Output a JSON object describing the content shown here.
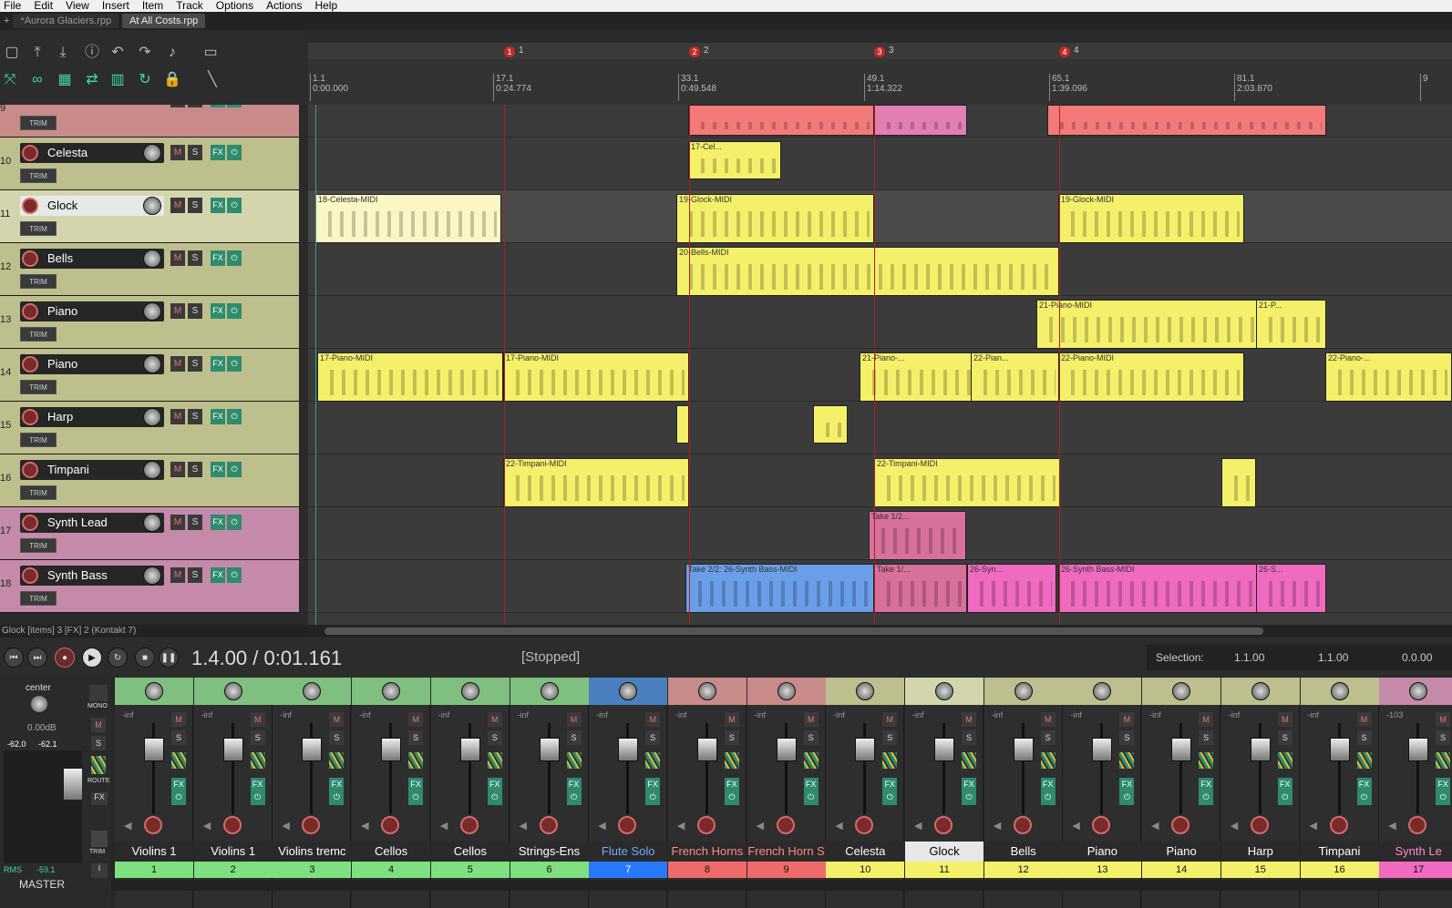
{
  "menu": [
    "File",
    "Edit",
    "View",
    "Insert",
    "Item",
    "Track",
    "Options",
    "Actions",
    "Help"
  ],
  "project_tabs": [
    "*Aurora Glaciers.rpp",
    "At All Costs.rpp"
  ],
  "toolbar_icons": [
    "new-project-icon",
    "open-icon",
    "save-icon",
    "info-icon",
    "undo-icon",
    "redo-icon",
    "metronome-icon",
    "window-icon",
    "ripple-icon",
    "link-icon",
    "grid-icon",
    "snap-icon",
    "grid-lines-icon",
    "loop-icon",
    "lock-icon",
    "razor-icon"
  ],
  "markers": [
    {
      "num": "1",
      "label": "1"
    },
    {
      "num": "2",
      "label": "2"
    },
    {
      "num": "3",
      "label": "3"
    },
    {
      "num": "4",
      "label": "4"
    }
  ],
  "ruler": [
    {
      "bar": "1.1",
      "time": "0:00.000"
    },
    {
      "bar": "17.1",
      "time": "0:24.774"
    },
    {
      "bar": "33.1",
      "time": "0:49.548"
    },
    {
      "bar": "49.1",
      "time": "1:14.322"
    },
    {
      "bar": "65.1",
      "time": "1:39.096"
    },
    {
      "bar": "81.1",
      "time": "2:03.870"
    },
    {
      "bar": "9",
      "time": ""
    }
  ],
  "tracks": [
    {
      "num": "9",
      "name": "",
      "color": "#c98a8a"
    },
    {
      "num": "10",
      "name": "Celesta",
      "color": "#bdbf8c"
    },
    {
      "num": "11",
      "name": "Glock",
      "color": "#d3d6ad",
      "selected": true
    },
    {
      "num": "12",
      "name": "Bells",
      "color": "#bdbf8c"
    },
    {
      "num": "13",
      "name": "Piano",
      "color": "#bdbf8c"
    },
    {
      "num": "14",
      "name": "Piano",
      "color": "#bdbf8c"
    },
    {
      "num": "15",
      "name": "Harp",
      "color": "#bdbf8c"
    },
    {
      "num": "16",
      "name": "Timpani",
      "color": "#bdbf8c"
    },
    {
      "num": "17",
      "name": "Synth Lead",
      "color": "#c58aa9"
    },
    {
      "num": "18",
      "name": "Synth Bass",
      "color": "#c58aa9"
    }
  ],
  "track_buttons": {
    "mute": "M",
    "solo": "S",
    "fx": "FX",
    "trim": "TRIM"
  },
  "items": [
    {
      "lane": 0,
      "label": "",
      "color": "#f47a7a"
    },
    {
      "lane": 0,
      "label": "",
      "color": "#e07fb0"
    },
    {
      "lane": 0,
      "label": "",
      "color": "#f47a7a"
    },
    {
      "lane": 1,
      "label": "17-Cel...",
      "color": "#f5f06a"
    },
    {
      "lane": 2,
      "label": "18-Celesta-MIDI",
      "color": "#fbf7c4"
    },
    {
      "lane": 2,
      "label": "19-Glock-MIDI",
      "color": "#f5f06a"
    },
    {
      "lane": 2,
      "label": "19-Glock-MIDI",
      "color": "#f5f06a"
    },
    {
      "lane": 3,
      "label": "20-Bells-MIDI",
      "color": "#f5f06a"
    },
    {
      "lane": 4,
      "label": "21-Piano-MIDI",
      "color": "#f5f06a"
    },
    {
      "lane": 4,
      "label": "21-P...",
      "color": "#f5f06a"
    },
    {
      "lane": 5,
      "label": "17-Piano-MIDI",
      "color": "#f5f06a"
    },
    {
      "lane": 5,
      "label": "17-Piano-MIDI",
      "color": "#f5f06a"
    },
    {
      "lane": 5,
      "label": "21-Piano-...",
      "color": "#f5f06a"
    },
    {
      "lane": 5,
      "label": "22-Pian...",
      "color": "#f5f06a"
    },
    {
      "lane": 5,
      "label": "22-Piano-MIDI",
      "color": "#f5f06a"
    },
    {
      "lane": 5,
      "label": "22-Piano-...",
      "color": "#f5f06a"
    },
    {
      "lane": 6,
      "label": "",
      "color": "#f5f06a"
    },
    {
      "lane": 6,
      "label": "",
      "color": "#f5f06a"
    },
    {
      "lane": 7,
      "label": "22-Timpani-MIDI",
      "color": "#f5f06a"
    },
    {
      "lane": 7,
      "label": "22-Timpani-MIDI",
      "color": "#f5f06a"
    },
    {
      "lane": 7,
      "label": "",
      "color": "#f5f06a"
    },
    {
      "lane": 8,
      "label": "Take 1/2...",
      "color": "#d8709c"
    },
    {
      "lane": 9,
      "label": "Take 2/2: 26-Synth Bass-MIDI",
      "color": "#6a9ee8"
    },
    {
      "lane": 9,
      "label": "Take 1/...",
      "color": "#d8709c"
    },
    {
      "lane": 9,
      "label": "26-Syn...",
      "color": "#f06ac0"
    },
    {
      "lane": 9,
      "label": "26-Synth Bass-MIDI",
      "color": "#f06ac0"
    },
    {
      "lane": 9,
      "label": "26-S...",
      "color": "#f06ac0"
    }
  ],
  "status": "Glock [items] 3 [FX] 2 (Kontakt 7)",
  "transport": {
    "position": "1.4.00 / 0:01.161",
    "state": "[Stopped]",
    "selection_label": "Selection:",
    "sel_start": "1.1.00",
    "sel_end": "1.1.00",
    "sel_len": "0.0.00"
  },
  "master": {
    "pan_label": "center",
    "vol": "0.00dB",
    "peak_l": "-62.0",
    "peak_r": "-62.1",
    "rms_label": "RMS",
    "rms_val": "-59.1",
    "name": "MASTER",
    "mono": "MONO",
    "route": "ROUTE",
    "fx": "FX",
    "trim": "TRIM",
    "info": "i"
  },
  "mixer_strips": [
    {
      "name": "Violins 1",
      "num": "1",
      "color": "#7fbf7f",
      "numcolor": "#7fe07f",
      "vol": "-inf",
      "namecolor": "#ffffff"
    },
    {
      "name": "Violins 1",
      "num": "2",
      "color": "#7fbf7f",
      "numcolor": "#7fe07f",
      "vol": "-inf",
      "namecolor": "#ffffff"
    },
    {
      "name": "Violins tremc",
      "num": "3",
      "color": "#7fbf7f",
      "numcolor": "#7fe07f",
      "vol": "-inf",
      "namecolor": "#ffffff"
    },
    {
      "name": "Cellos",
      "num": "4",
      "color": "#7fbf7f",
      "numcolor": "#7fe07f",
      "vol": "-inf",
      "namecolor": "#ffffff"
    },
    {
      "name": "Cellos",
      "num": "5",
      "color": "#7fbf7f",
      "numcolor": "#7fe07f",
      "vol": "-inf",
      "namecolor": "#ffffff"
    },
    {
      "name": "Strings-Ens",
      "num": "6",
      "color": "#7fbf7f",
      "numcolor": "#7fe07f",
      "vol": "-inf",
      "namecolor": "#ffffff"
    },
    {
      "name": "Flute Solo",
      "num": "7",
      "color": "#4a7fc0",
      "numcolor": "#2979ff",
      "vol": "-inf",
      "namecolor": "#6fa8ff"
    },
    {
      "name": "French Horns",
      "num": "8",
      "color": "#c98a8a",
      "numcolor": "#f06a6a",
      "vol": "-inf",
      "namecolor": "#ff8a8a"
    },
    {
      "name": "French Horn S",
      "num": "9",
      "color": "#c98a8a",
      "numcolor": "#f06a6a",
      "vol": "-inf",
      "namecolor": "#ff8a8a"
    },
    {
      "name": "Celesta",
      "num": "10",
      "color": "#bdbf8c",
      "numcolor": "#f5f06a",
      "vol": "-inf",
      "namecolor": "#ffffff"
    },
    {
      "name": "Glock",
      "num": "11",
      "color": "#d3d6ad",
      "numcolor": "#f5f06a",
      "vol": "-inf",
      "namecolor": "#000000",
      "selected": true
    },
    {
      "name": "Bells",
      "num": "12",
      "color": "#bdbf8c",
      "numcolor": "#f5f06a",
      "vol": "-inf",
      "namecolor": "#ffffff"
    },
    {
      "name": "Piano",
      "num": "13",
      "color": "#bdbf8c",
      "numcolor": "#f5f06a",
      "vol": "-inf",
      "namecolor": "#ffffff"
    },
    {
      "name": "Piano",
      "num": "14",
      "color": "#bdbf8c",
      "numcolor": "#f5f06a",
      "vol": "-inf",
      "namecolor": "#ffffff"
    },
    {
      "name": "Harp",
      "num": "15",
      "color": "#bdbf8c",
      "numcolor": "#f5f06a",
      "vol": "-inf",
      "namecolor": "#ffffff"
    },
    {
      "name": "Timpani",
      "num": "16",
      "color": "#bdbf8c",
      "numcolor": "#f5f06a",
      "vol": "-inf",
      "namecolor": "#ffffff"
    },
    {
      "name": "Synth Le",
      "num": "17",
      "color": "#c58aa9",
      "numcolor": "#f06ac0",
      "vol": "-103",
      "namecolor": "#ff8ad0"
    }
  ]
}
